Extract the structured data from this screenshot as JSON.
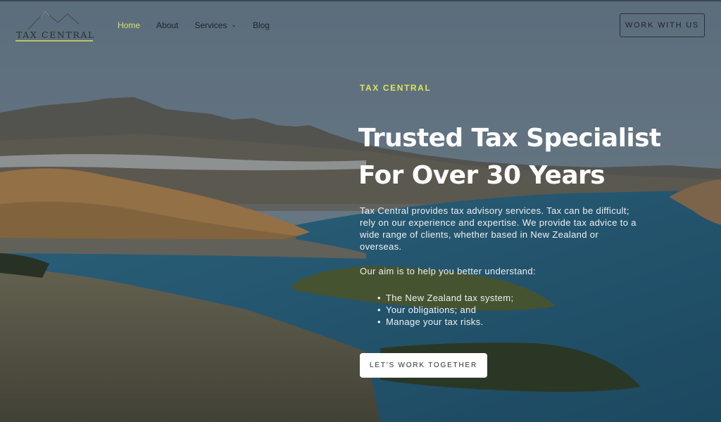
{
  "brand": {
    "logo_text": "TAX CENTRAL",
    "accent_color": "#d9e85a"
  },
  "nav": {
    "items": [
      {
        "label": "Home",
        "active": true
      },
      {
        "label": "About",
        "active": false
      },
      {
        "label": "Services",
        "active": false,
        "has_dropdown": true
      },
      {
        "label": "Blog",
        "active": false
      }
    ],
    "cta_label": "WORK WITH US"
  },
  "hero": {
    "eyebrow": "TAX CENTRAL",
    "headline_line1": "Trusted Tax Specialist",
    "headline_line2": "For Over 30 Years",
    "description": "Tax Central provides tax advisory services. Tax can be difficult; rely on our experience and expertise. We provide tax advice to a wide range of clients, whether based in New Zealand or overseas.",
    "aim_intro": "Our aim is to help you better understand:",
    "bullets": [
      "The New Zealand tax system;",
      "Your obligations; and",
      "Manage your tax risks."
    ],
    "cta_label": "LET'S WORK TOGETHER",
    "background_image": "aerial-lake-mountains-town"
  }
}
